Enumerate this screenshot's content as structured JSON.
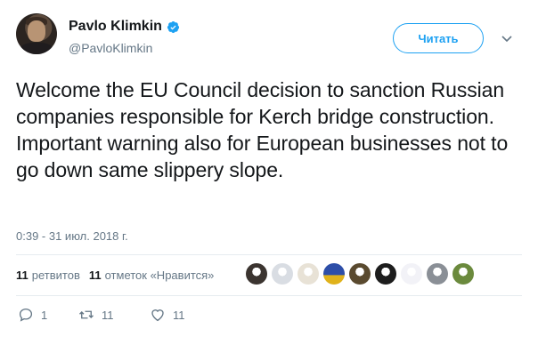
{
  "author": {
    "display_name": "Pavlo Klimkin",
    "handle": "@PavloKlimkin",
    "verified": true,
    "avatar_icon": "person-avatar-icon"
  },
  "follow_button_label": "Читать",
  "menu_icon": "chevron-down-icon",
  "tweet": {
    "text": "Welcome the EU Council decision to sanction Russian companies responsible for Kerch bridge construction. Important warning also for European businesses not to go down same slippery slope.",
    "timestamp": "0:39 - 31 июл. 2018 г."
  },
  "stats": {
    "retweets_count": "11",
    "retweets_label": "ретвитов",
    "likes_count": "11",
    "likes_label": "отметок «Нравится»"
  },
  "likers": [
    {
      "icon": "avatar-1",
      "color": "#3b3430"
    },
    {
      "icon": "avatar-2",
      "color": "#d9dde3"
    },
    {
      "icon": "avatar-3",
      "color": "#e8e2d6"
    },
    {
      "icon": "avatar-4",
      "color": "#2d4ea8"
    },
    {
      "icon": "avatar-5",
      "color": "#5a4a2f"
    },
    {
      "icon": "avatar-6",
      "color": "#1d1d1d"
    },
    {
      "icon": "avatar-7",
      "color": "#f2f2f7"
    },
    {
      "icon": "avatar-8",
      "color": "#8a8f96"
    },
    {
      "icon": "avatar-9",
      "color": "#6b8a3d"
    }
  ],
  "actions": {
    "replies": "1",
    "retweets": "11",
    "likes": "11"
  },
  "colors": {
    "accent": "#1da1f2",
    "text": "#14171a",
    "secondary": "#657786",
    "divider": "#e6ecf0"
  }
}
